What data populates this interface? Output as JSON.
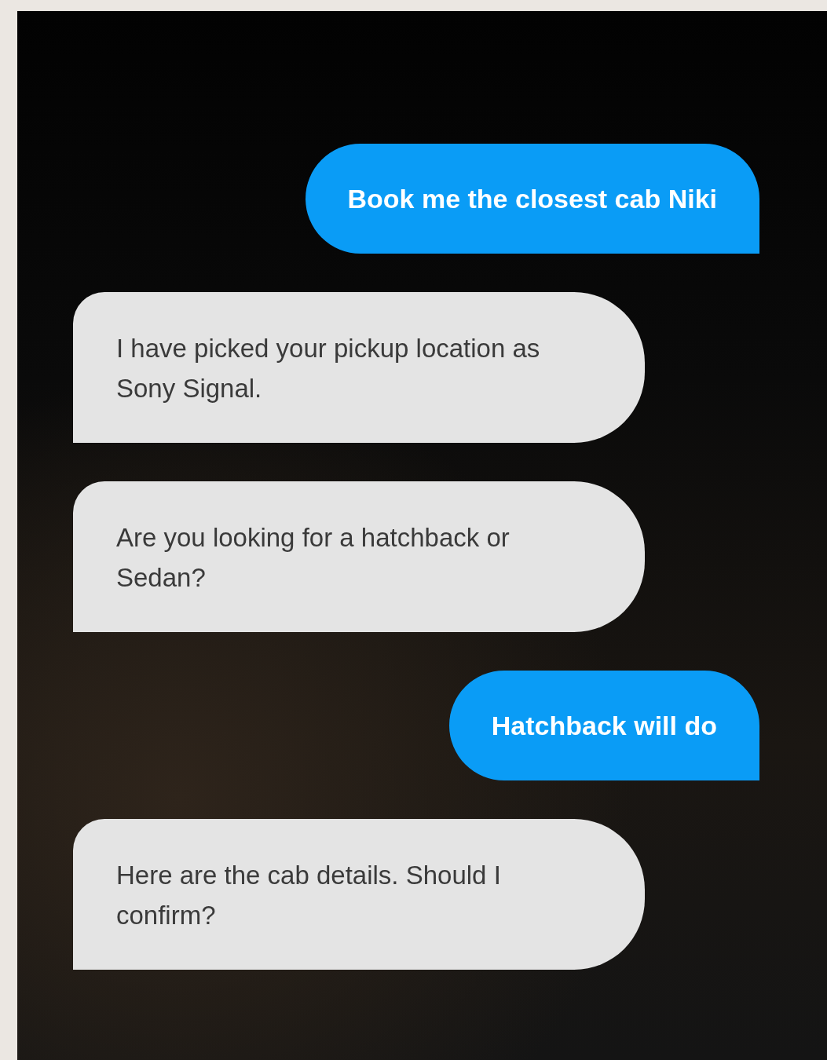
{
  "messages": [
    {
      "kind": "user",
      "text": "Book me the closest cab Niki"
    },
    {
      "kind": "bot",
      "text": "I have picked your pickup location as Sony Signal."
    },
    {
      "kind": "bot",
      "text": "Are you looking for a hatchback or Sedan?"
    },
    {
      "kind": "user",
      "text": "Hatchback will do"
    },
    {
      "kind": "bot",
      "text": "Here are the cab details. Should I confirm?"
    }
  ]
}
